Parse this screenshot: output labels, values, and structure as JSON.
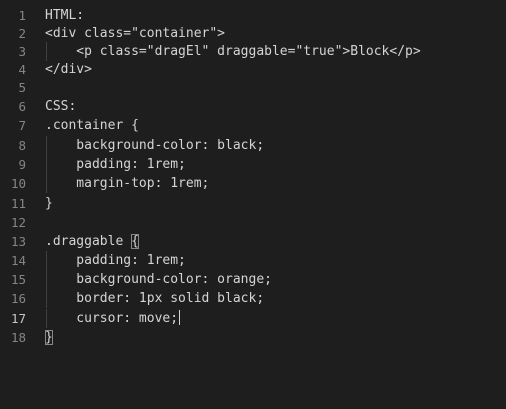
{
  "editor": {
    "lines": [
      {
        "num": "1",
        "text": "HTML:"
      },
      {
        "num": "2",
        "text": "<div class=\"container\">"
      },
      {
        "num": "3",
        "text": "    <p class=\"dragEl\" draggable=\"true\">Block</p>"
      },
      {
        "num": "4",
        "text": "</div>"
      },
      {
        "num": "5",
        "text": ""
      },
      {
        "num": "6",
        "text": "CSS:"
      },
      {
        "num": "7",
        "text": ".container {"
      },
      {
        "num": "8",
        "text": "    background-color: black;"
      },
      {
        "num": "9",
        "text": "    padding: 1rem;"
      },
      {
        "num": "10",
        "text": "    margin-top: 1rem;"
      },
      {
        "num": "11",
        "text": "}"
      },
      {
        "num": "12",
        "text": ""
      },
      {
        "num": "13",
        "text_before": ".draggable ",
        "bracket": "{",
        "text_after": ""
      },
      {
        "num": "14",
        "text": "    padding: 1rem;"
      },
      {
        "num": "15",
        "text": "    background-color: orange;"
      },
      {
        "num": "16",
        "text": "    border: 1px solid black;"
      },
      {
        "num": "17",
        "text": "    cursor: move;"
      },
      {
        "num": "18",
        "text_before": "",
        "bracket": "}",
        "text_after": ""
      }
    ],
    "active_line": "17"
  }
}
